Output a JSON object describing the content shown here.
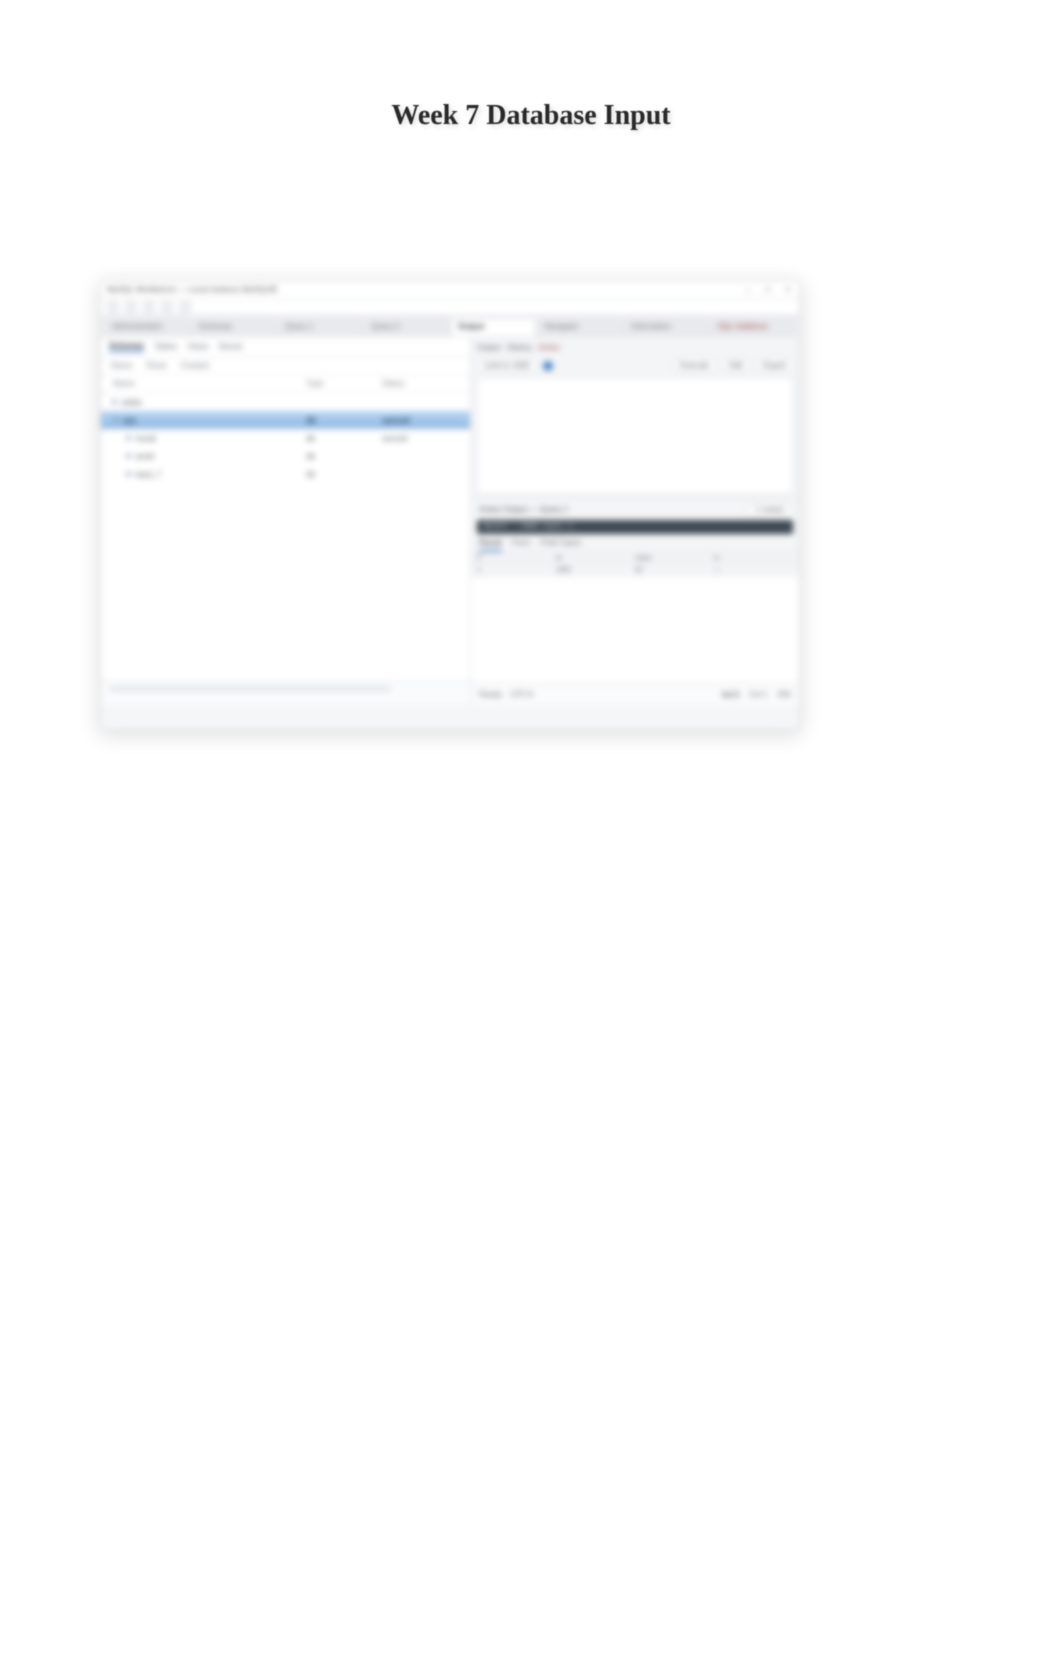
{
  "page": {
    "title": "Week 7 Database Input"
  },
  "window": {
    "title": "MySQL Workbench — Local instance MySQL80",
    "controls": {
      "min": "–",
      "max": "□",
      "close": "×"
    }
  },
  "main_tabs": [
    "Administration",
    "Schemas",
    "Query 1",
    "Query 2",
    "Output"
  ],
  "main_tabs_right": [
    "Navigator",
    "Information",
    "SQL Additions"
  ],
  "active_main_tab_index": 4,
  "left": {
    "subtabs": [
      "Schemas",
      "Tables",
      "Views",
      "Stored"
    ],
    "active_subtab_index": 0,
    "columns": [
      "Name",
      "Rows",
      "Created"
    ],
    "header": {
      "c1": "Name",
      "c2": "Type",
      "c3": "Status"
    },
    "rows": [
      {
        "name": "sakila",
        "type": "",
        "status": ""
      },
      {
        "name": "sys",
        "type": "db",
        "status": "synced",
        "selected": true
      },
      {
        "name": "mysql",
        "type": "db",
        "status": "synced"
      },
      {
        "name": "world",
        "type": "db",
        "status": ""
      },
      {
        "name": "input_7",
        "type": "db",
        "status": ""
      }
    ]
  },
  "right_top": {
    "header_items": [
      "Output",
      "History",
      "Action"
    ],
    "toolbar": {
      "label_left": "Limit to 1000",
      "exec_label": "Execute",
      "btn1": "Edit",
      "btn2": "Export"
    }
  },
  "right_bottom": {
    "title": "Action Output — Query 1",
    "badge": "1 row(s)",
    "query": "SELECT * FROM input_7;",
    "tabs": [
      "Result",
      "Form",
      "Field Types"
    ],
    "active_tab_index": 0,
    "grid": {
      "columns": [
        "#",
        "id",
        "value",
        "ts"
      ],
      "row": [
        "1",
        "1001",
        "42",
        "—"
      ]
    }
  },
  "bottom_bar": {
    "left": [
      "Ready",
      "UTF-8"
    ],
    "right": [
      "Ln 1",
      "Col 1",
      "INS"
    ],
    "active_index": 0
  },
  "corner": ""
}
